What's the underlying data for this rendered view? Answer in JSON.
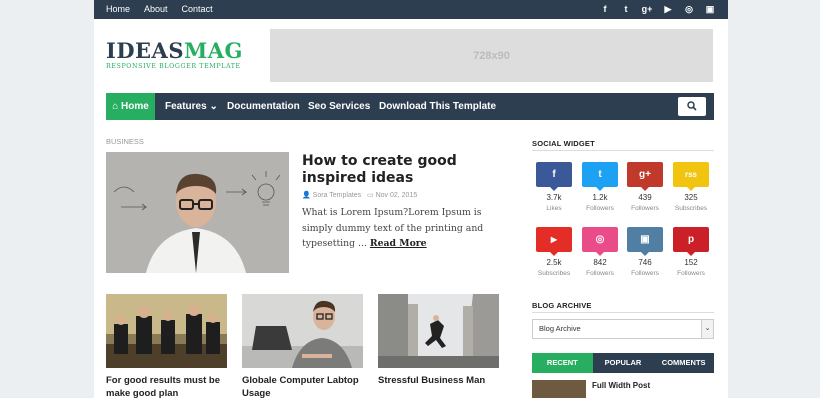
{
  "topbar": {
    "links": [
      "Home",
      "About",
      "Contact"
    ],
    "social_icons": [
      "facebook-icon",
      "twitter-icon",
      "googleplus-icon",
      "youtube-icon",
      "dribbble-icon",
      "instagram-icon"
    ]
  },
  "logo": {
    "part1": "IDEAS",
    "part2": "MAG",
    "tagline": "RESPONSIVE BLOGGER TEMPLATE"
  },
  "ad": {
    "label": "728x90"
  },
  "nav": {
    "home": "Home",
    "features": "Features",
    "documentation": "Documentation",
    "seo": "Seo Services",
    "download": "Download This Template"
  },
  "featured": {
    "label": "BUSINESS",
    "title": "How to create good inspired ideas",
    "author": "Sora Templates",
    "date": "Nov 02, 2015",
    "excerpt": "What is Lorem Ipsum?Lorem Ipsum is simply dummy text of the printing and typesetting ...",
    "read_more": "Read More"
  },
  "posts": [
    {
      "title": "For good results must be make good plan"
    },
    {
      "title": "Globale Computer Labtop Usage"
    },
    {
      "title": "Stressful Business Man"
    }
  ],
  "sidebar": {
    "social_title": "SOCIAL WIDGET",
    "social": [
      {
        "icon": "facebook-icon",
        "glyph": "f",
        "color": "#3b5998",
        "count": "3.7k",
        "label": "Likes"
      },
      {
        "icon": "twitter-icon",
        "glyph": "t",
        "color": "#1da1f2",
        "count": "1.2k",
        "label": "Followers"
      },
      {
        "icon": "googleplus-icon",
        "glyph": "g+",
        "color": "#c0392b",
        "count": "439",
        "label": "Followers"
      },
      {
        "icon": "rss-icon",
        "glyph": "rss",
        "color": "#f1c40f",
        "count": "325",
        "label": "Subscribes"
      },
      {
        "icon": "youtube-icon",
        "glyph": "▶",
        "color": "#e52d27",
        "count": "2.5k",
        "label": "Subscribes"
      },
      {
        "icon": "dribbble-icon",
        "glyph": "◎",
        "color": "#ea4c89",
        "count": "842",
        "label": "Followers"
      },
      {
        "icon": "instagram-icon",
        "glyph": "▣",
        "color": "#517fa4",
        "count": "746",
        "label": "Followers"
      },
      {
        "icon": "pinterest-icon",
        "glyph": "p",
        "color": "#cb2027",
        "count": "152",
        "label": "Followers"
      }
    ],
    "archive_title": "BLOG ARCHIVE",
    "archive_value": "Blog Archive",
    "tabs": [
      "RECENT",
      "POPULAR",
      "COMMENTS"
    ],
    "recent_first": "Full Width Post"
  },
  "colors": {
    "dark": "#2c3e50",
    "accent": "#27ae60"
  }
}
